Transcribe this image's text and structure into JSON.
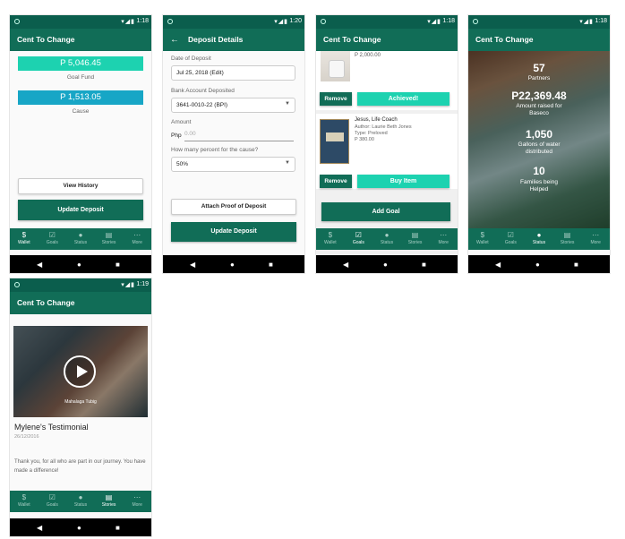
{
  "colors": {
    "dark_green": "#116d57",
    "status_green": "#0b5e4d",
    "teal": "#1dd2b0",
    "blue": "#17a6c6"
  },
  "status_bar": {
    "time_a": "1:18",
    "time_b": "1:20",
    "time_c": "1:18",
    "time_d": "1:18",
    "time_e": "1:19",
    "icons": "▾◢▮"
  },
  "app_title": "Cent To Change",
  "nav": {
    "wallet": "Wallet",
    "goals": "Goals",
    "status": "Status",
    "stories": "Stories",
    "more": "More"
  },
  "nav_icons": {
    "wallet": "$",
    "goals": "☑",
    "status": "●",
    "stories": "▤",
    "more": "⋯"
  },
  "sysnav_icons": {
    "back": "◀",
    "home": "●",
    "recents": "■"
  },
  "wallet": {
    "goal_amount": "P 5,046.45",
    "goal_label": "Goal Fund",
    "cause_amount": "P 1,513.05",
    "cause_label": "Cause",
    "view_history": "View History",
    "update_deposit": "Update Deposit"
  },
  "deposit": {
    "title": "Deposit Details",
    "date_label": "Date of Deposit",
    "date_value": "Jul 25, 2018 (Edit)",
    "bank_label": "Bank Account Deposited",
    "bank_value": "3641-0010-22 (BPI)",
    "amount_label": "Amount",
    "currency": "Php",
    "amount_placeholder": "0.00",
    "percent_label": "How many percent for the cause?",
    "percent_value": "50%",
    "attach": "Attach Proof of Deposit",
    "update": "Update Deposit"
  },
  "goals": {
    "item1_price": "P 2,000.00",
    "remove": "Remove",
    "achieved": "Achieved!",
    "item2_title": "Jesus, Life Coach",
    "item2_author": "Author: Laurie Beth Jones",
    "item2_type": "Type: Preloved",
    "item2_price": "P 380.00",
    "buy": "Buy Item",
    "add_goal": "Add Goal"
  },
  "status": {
    "partners_value": "57",
    "partners_label": "Partners",
    "amount_value": "P22,369.48",
    "amount_label": "Amount raised for Baseco",
    "water_value": "1,050",
    "water_label": "Gallons of water distributed",
    "families_value": "10",
    "families_label": "Families being Helped"
  },
  "stories": {
    "caption": "Mahalaga Tubig",
    "title": "Mylene's Testimonial",
    "date": "26/12/2016",
    "body": "Thank you, for all who are part in our journey. You have made a difference!"
  }
}
